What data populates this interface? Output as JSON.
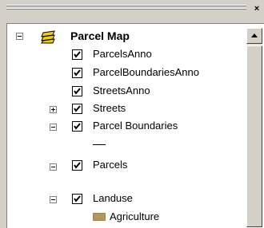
{
  "toc": {
    "close_glyph": "×",
    "group": {
      "label": "Parcel Map",
      "expanded": true,
      "layers": [
        {
          "label": "ParcelsAnno",
          "checked": true
        },
        {
          "label": "ParcelBoundariesAnno",
          "checked": true
        },
        {
          "label": "StreetsAnno",
          "checked": true
        },
        {
          "label": "Streets",
          "checked": true,
          "expanded": false
        },
        {
          "label": "Parcel Boundaries",
          "checked": true,
          "expanded": true
        },
        {
          "label": "Parcels",
          "checked": true,
          "expanded": true
        },
        {
          "label": "Landuse",
          "checked": true,
          "expanded": true
        }
      ],
      "legend": {
        "landuse_class": "Agriculture"
      }
    }
  },
  "colors": {
    "panel_bg": "#ffffff",
    "chrome": "#d4d0c8",
    "agriculture_swatch": "#b4955e",
    "layers_icon": "#f0d000"
  },
  "icons": {
    "group": "layers-icon",
    "expand": "plus-box-icon",
    "collapse": "minus-box-icon",
    "check": "check-icon"
  }
}
